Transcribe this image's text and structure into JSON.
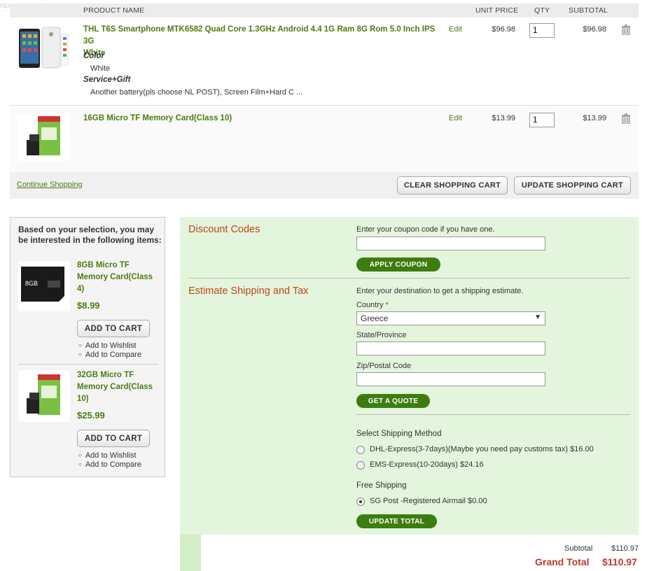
{
  "corner_text": "nip",
  "header": {
    "product_name": "PRODUCT NAME",
    "unit_price": "UNIT PRICE",
    "qty": "QTY",
    "subtotal": "SUBTOTAL"
  },
  "items": [
    {
      "name_line1": "THL T6S Smartphone MTK6582 Quad Core 1.3GHz Android 4.4 1G Ram 8G Rom 5.0 Inch IPS 3G",
      "name_line2": "White",
      "edit": "Edit",
      "price": "$96.98",
      "qty": "1",
      "subtotal": "$96.98",
      "options": [
        {
          "label": "Color",
          "value": "White"
        },
        {
          "label": "Service+Gift",
          "value": "Another battery(pls choose NL POST), Screen Film+Hard C ..."
        }
      ],
      "icon": "trash-icon"
    },
    {
      "name_line1": "16GB Micro TF Memory Card(Class 10)",
      "edit": "Edit",
      "price": "$13.99",
      "qty": "1",
      "subtotal": "$13.99",
      "icon": "trash-icon"
    }
  ],
  "actions": {
    "continue": "Continue Shopping",
    "clear": "CLEAR SHOPPING CART",
    "update": "UPDATE SHOPPING CART"
  },
  "crosssell": {
    "title": "Based on your selection, you may be interested in the following items:",
    "products": [
      {
        "name_l1": "8GB Micro TF",
        "name_l2": "Memory Card(Class",
        "name_l3": "4)",
        "price": "$8.99",
        "add": "ADD TO CART",
        "wishlist": "Add to Wishlist",
        "compare": "Add to Compare",
        "image_text": "8GB"
      },
      {
        "name_l1": "32GB Micro TF",
        "name_l2": "Memory Card(Class",
        "name_l3": "10)",
        "price": "$25.99",
        "add": "ADD TO CART",
        "wishlist": "Add to Wishlist",
        "compare": "Add to Compare"
      }
    ]
  },
  "discount": {
    "title": "Discount Codes",
    "prompt": "Enter your coupon code if you have one.",
    "code_value": "",
    "apply": "APPLY COUPON"
  },
  "shipping": {
    "title": "Estimate Shipping and Tax",
    "prompt": "Enter your destination to get a shipping estimate.",
    "country_label": "Country",
    "required_mark": "*",
    "country_value": "Greece",
    "state_label": "State/Province",
    "state_value": "",
    "zip_label": "Zip/Postal Code",
    "zip_value": "",
    "quote": "GET A QUOTE",
    "method_title": "Select Shipping Method",
    "methods": [
      {
        "label": "DHL-Express(3-7days)(Maybe you need pay customs tax) $16.00",
        "selected": false
      },
      {
        "label": "EMS-Express(10-20days) $24.16",
        "selected": false
      }
    ],
    "free_title": "Free Shipping",
    "free_method": {
      "label": "SG Post -Registered Airmail $0.00",
      "selected": true
    },
    "update_total": "UPDATE TOTAL"
  },
  "totals": {
    "subtotal_label": "Subtotal",
    "subtotal_value": "$110.97",
    "grand_label": "Grand Total",
    "grand_value": "$110.97"
  },
  "colors": {
    "accent_green": "#4a7c12",
    "button_green": "#3d7d10",
    "section_title": "#c0461b",
    "panel_bg": "#e3f5dc",
    "grand_total": "#c0392b"
  }
}
